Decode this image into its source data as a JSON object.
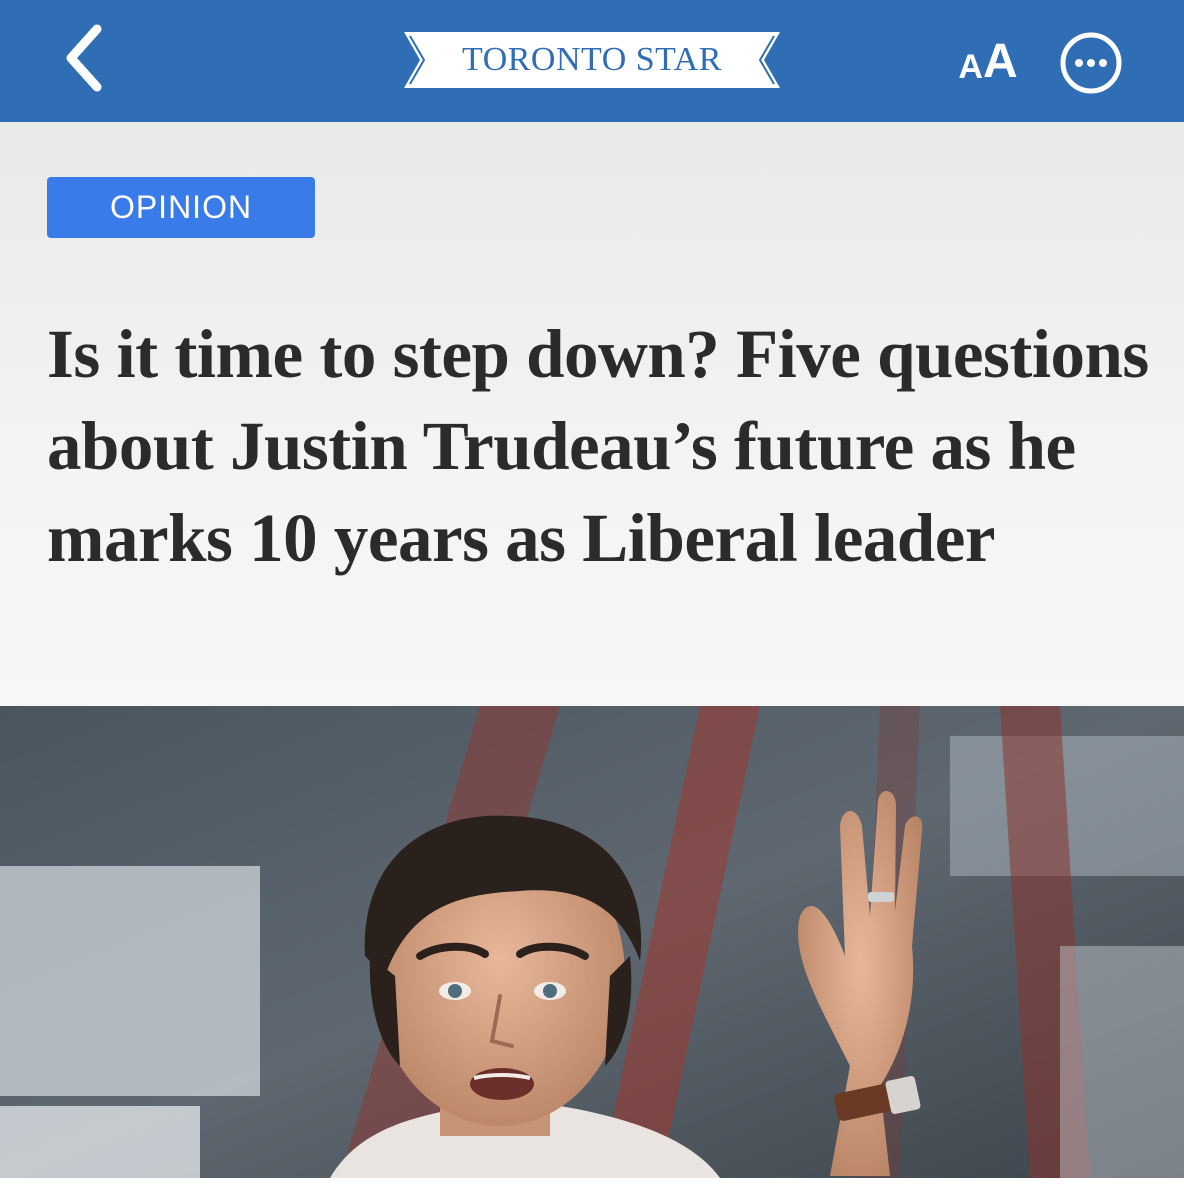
{
  "header": {
    "back_icon": "chevron-left-icon",
    "logo_text": "TORONTO STAR",
    "text_size_small": "A",
    "text_size_large": "A",
    "more_icon": "ellipsis-circle-icon",
    "bar_color": "#2f6db5"
  },
  "article": {
    "category": "OPINION",
    "category_color": "#3a7bea",
    "headline": "Is it time to step down? Five questions about Justin Trudeau’s future as he marks 10 years as Liberal leader"
  },
  "hero_image": {
    "subject": "man speaking with raised hand"
  }
}
